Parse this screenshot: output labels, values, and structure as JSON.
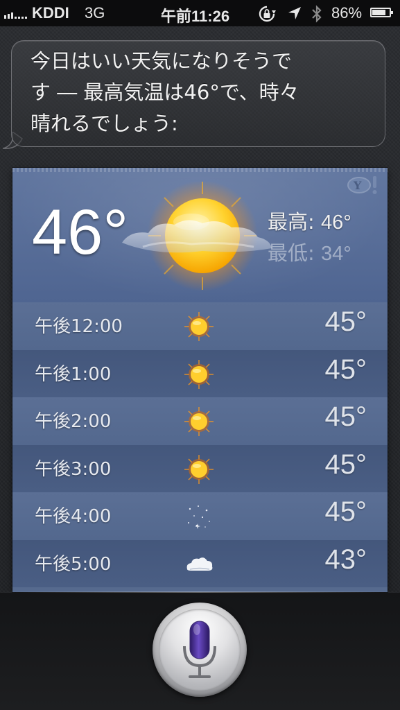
{
  "status_bar": {
    "carrier": "KDDI",
    "network": "3G",
    "time": "午前11:26",
    "battery_percent": "86%",
    "battery_level": 0.86,
    "icons": [
      "signal-icon",
      "rotation-lock-icon",
      "location-icon",
      "bluetooth-icon",
      "battery-icon"
    ]
  },
  "siri": {
    "response": "今日はいい天気になりそうで\nす ― 最高気温は46°で、時々\n晴れるでしょう:"
  },
  "weather": {
    "current_temp": "46°",
    "high_label": "最高:",
    "high_value": "46°",
    "low_label": "最低:",
    "low_value": "34°",
    "condition_icon": "partly-cloudy-sun-icon",
    "provider_icon": "yahoo-logo-icon",
    "hourly": [
      {
        "hour": "午後12:00",
        "icon": "sun-icon",
        "temp": "45°"
      },
      {
        "hour": "午後1:00",
        "icon": "sun-icon",
        "temp": "45°"
      },
      {
        "hour": "午後2:00",
        "icon": "sun-icon",
        "temp": "45°"
      },
      {
        "hour": "午後3:00",
        "icon": "sun-icon",
        "temp": "45°"
      },
      {
        "hour": "午後4:00",
        "icon": "clear-night-stars-icon",
        "temp": "45°"
      },
      {
        "hour": "午後5:00",
        "icon": "cloud-icon",
        "temp": "43°"
      }
    ]
  },
  "colors": {
    "card_blue": "#566a8e",
    "sun_yellow": "#ffd23a",
    "mic_purple": "#5a3fa0"
  },
  "mic": {
    "icon": "microphone-icon"
  }
}
